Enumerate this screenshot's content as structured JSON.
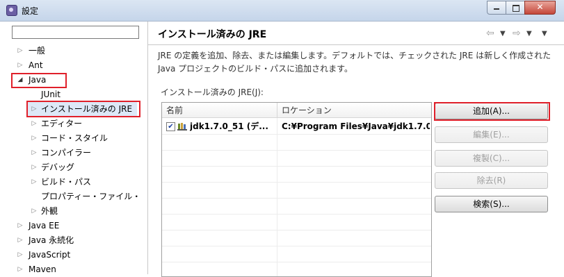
{
  "window": {
    "title": "設定",
    "controls": {
      "minimize": "—",
      "maximize": "☐",
      "close": "✕"
    }
  },
  "tree": {
    "filter_value": "",
    "items": [
      {
        "label": "一般",
        "expander": "collapsed"
      },
      {
        "label": "Ant",
        "expander": "collapsed"
      },
      {
        "label": "Java",
        "expander": "expanded"
      },
      {
        "label": "JUnit",
        "expander": "none"
      },
      {
        "label": "インストール済みの JRE",
        "expander": "collapsed"
      },
      {
        "label": "エディター",
        "expander": "collapsed"
      },
      {
        "label": "コード・スタイル",
        "expander": "collapsed"
      },
      {
        "label": "コンパイラー",
        "expander": "collapsed"
      },
      {
        "label": "デバッグ",
        "expander": "collapsed"
      },
      {
        "label": "ビルド・パス",
        "expander": "collapsed"
      },
      {
        "label": "プロパティー・ファイル・",
        "expander": "none"
      },
      {
        "label": "外観",
        "expander": "collapsed"
      },
      {
        "label": "Java EE",
        "expander": "collapsed"
      },
      {
        "label": "Java 永続化",
        "expander": "collapsed"
      },
      {
        "label": "JavaScript",
        "expander": "collapsed"
      },
      {
        "label": "Maven",
        "expander": "collapsed"
      }
    ]
  },
  "page": {
    "title": "インストール済みの JRE",
    "description_line1": "JRE の定義を追加、除去、または編集します。デフォルトでは、チェックされた JRE は新しく作成された",
    "description_line2": "Java プロジェクトのビルド・パスに追加されます。",
    "jre_label": "インストール済みの JRE(J):",
    "nav": {
      "back": "⇦",
      "forward": "⇨",
      "dropdown": "▼"
    }
  },
  "table": {
    "headers": [
      "名前",
      "ロケーション"
    ],
    "rows": [
      {
        "checked": true,
        "name": "jdk1.7.0_51 (デ...",
        "location": "C:¥Program Files¥Java¥jdk1.7.0_"
      }
    ]
  },
  "buttons": {
    "add": "追加(A)...",
    "edit": "編集(E)...",
    "copy": "複製(C)...",
    "remove": "除去(R)",
    "search": "検索(S)..."
  },
  "colors": {
    "highlight": "#e0202a",
    "selection": "#dde8f7"
  }
}
